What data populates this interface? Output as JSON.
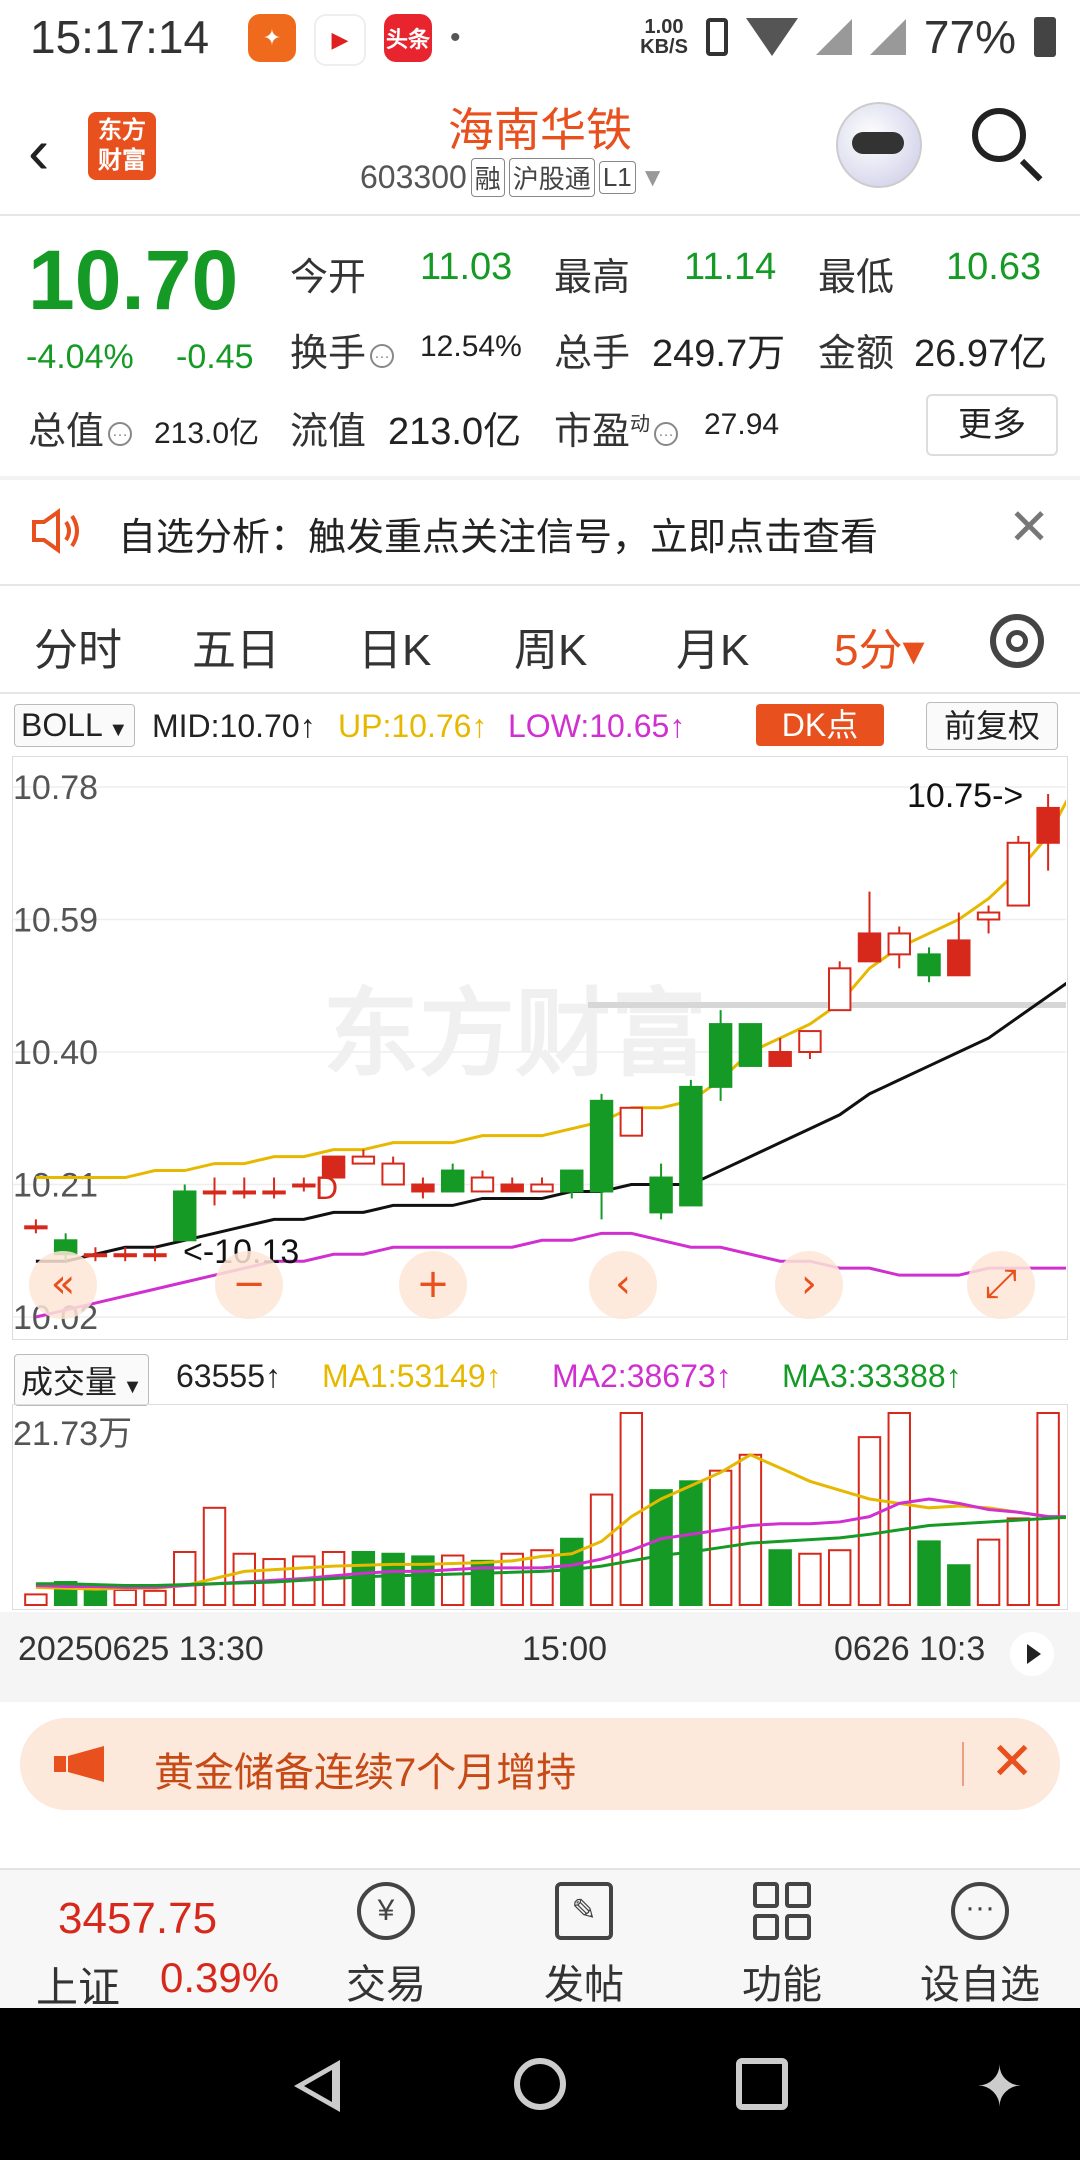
{
  "status": {
    "time": "15:17:14",
    "net_speed_value": "1.00",
    "net_speed_unit": "KB/S",
    "battery": "77%",
    "app1_label": "头条"
  },
  "header": {
    "logo_text": "东方财富",
    "stock_name": "海南华铁",
    "stock_code": "603300",
    "tags": [
      "融",
      "沪股通",
      "L1"
    ]
  },
  "quote": {
    "price": "10.70",
    "change_pct": "-4.04%",
    "change_abs": "-0.45",
    "open_label": "今开",
    "open": "11.03",
    "high_label": "最高",
    "high": "11.14",
    "low_label": "最低",
    "low": "10.63",
    "turnover_label": "换手",
    "turnover": "12.54%",
    "volume_label": "总手",
    "volume": "249.7万",
    "amount_label": "金额",
    "amount": "26.97亿",
    "total_value_label": "总值",
    "total_value": "213.0亿",
    "float_value_label": "流值",
    "float_value": "213.0亿",
    "pe_label": "市盈",
    "pe_sup": "动",
    "pe": "27.94",
    "more_label": "更多"
  },
  "notice": {
    "text": "自选分析：触发重点关注信号，立即点击查看"
  },
  "tabs": [
    "分时",
    "五日",
    "日K",
    "周K",
    "月K",
    "5分▾"
  ],
  "indicator": {
    "name": "BOLL",
    "mid": "MID:10.70↑",
    "up": "UP:10.76↑",
    "low": "LOW:10.65↑",
    "dk_label": "DK点",
    "adjust_label": "前复权"
  },
  "chart_labels": {
    "y_ticks": [
      "10.78",
      "10.59",
      "10.40",
      "10.21",
      "10.02"
    ],
    "high_marker": "10.75->",
    "low_marker": "<-10.13",
    "d_marker": "D",
    "watermark": "东方财富",
    "vol_max": "21.73万"
  },
  "volume": {
    "name": "成交量",
    "current": "63555↑",
    "ma1": "MA1:53149↑",
    "ma2": "MA2:38673↑",
    "ma3": "MA3:33388↑"
  },
  "time_axis": [
    "20250625 13:30",
    "15:00",
    "0626 10:3"
  ],
  "banner": {
    "text": "黄金储备连续7个月增持"
  },
  "bottom_bar": {
    "index_value": "3457.75",
    "index_name": "上证",
    "index_pct": "0.39%",
    "items": [
      "交易",
      "发帖",
      "功能",
      "设自选"
    ]
  },
  "colors": {
    "up": "#d7281c",
    "down": "#159a25",
    "accent": "#e8501e",
    "ma_yellow": "#e6b800",
    "ma_magenta": "#d030d0",
    "ma_black": "#111111"
  },
  "chart_data": {
    "type": "candlestick",
    "y_range": [
      10.02,
      10.78
    ],
    "candles": [
      {
        "o": 10.15,
        "c": 10.15,
        "h": 10.16,
        "l": 10.14
      },
      {
        "o": 10.13,
        "c": 10.11,
        "h": 10.14,
        "l": 10.1
      },
      {
        "o": 10.11,
        "c": 10.11,
        "h": 10.12,
        "l": 10.1
      },
      {
        "o": 10.11,
        "c": 10.11,
        "h": 10.12,
        "l": 10.1
      },
      {
        "o": 10.11,
        "c": 10.11,
        "h": 10.12,
        "l": 10.1
      },
      {
        "o": 10.2,
        "c": 10.13,
        "h": 10.21,
        "l": 10.13
      },
      {
        "o": 10.2,
        "c": 10.2,
        "h": 10.22,
        "l": 10.18
      },
      {
        "o": 10.2,
        "c": 10.2,
        "h": 10.22,
        "l": 10.19
      },
      {
        "o": 10.2,
        "c": 10.2,
        "h": 10.22,
        "l": 10.19
      },
      {
        "o": 10.21,
        "c": 10.21,
        "h": 10.22,
        "l": 10.2
      },
      {
        "o": 10.22,
        "c": 10.25,
        "h": 10.25,
        "l": 10.22
      },
      {
        "o": 10.24,
        "c": 10.25,
        "h": 10.26,
        "l": 10.24
      },
      {
        "o": 10.21,
        "c": 10.24,
        "h": 10.25,
        "l": 10.21
      },
      {
        "o": 10.2,
        "c": 10.21,
        "h": 10.22,
        "l": 10.19
      },
      {
        "o": 10.23,
        "c": 10.2,
        "h": 10.24,
        "l": 10.2
      },
      {
        "o": 10.2,
        "c": 10.22,
        "h": 10.23,
        "l": 10.2
      },
      {
        "o": 10.2,
        "c": 10.21,
        "h": 10.22,
        "l": 10.2
      },
      {
        "o": 10.2,
        "c": 10.21,
        "h": 10.22,
        "l": 10.2
      },
      {
        "o": 10.23,
        "c": 10.2,
        "h": 10.23,
        "l": 10.19
      },
      {
        "o": 10.33,
        "c": 10.2,
        "h": 10.34,
        "l": 10.16
      },
      {
        "o": 10.28,
        "c": 10.32,
        "h": 10.32,
        "l": 10.28
      },
      {
        "o": 10.22,
        "c": 10.17,
        "h": 10.24,
        "l": 10.16
      },
      {
        "o": 10.35,
        "c": 10.18,
        "h": 10.36,
        "l": 10.18
      },
      {
        "o": 10.44,
        "c": 10.35,
        "h": 10.46,
        "l": 10.33
      },
      {
        "o": 10.44,
        "c": 10.38,
        "h": 10.44,
        "l": 10.38
      },
      {
        "o": 10.38,
        "c": 10.4,
        "h": 10.42,
        "l": 10.38
      },
      {
        "o": 10.4,
        "c": 10.43,
        "h": 10.43,
        "l": 10.39
      },
      {
        "o": 10.46,
        "c": 10.52,
        "h": 10.53,
        "l": 10.46
      },
      {
        "o": 10.53,
        "c": 10.57,
        "h": 10.63,
        "l": 10.53
      },
      {
        "o": 10.54,
        "c": 10.57,
        "h": 10.58,
        "l": 10.52
      },
      {
        "o": 10.54,
        "c": 10.51,
        "h": 10.55,
        "l": 10.5
      },
      {
        "o": 10.51,
        "c": 10.56,
        "h": 10.6,
        "l": 10.51
      },
      {
        "o": 10.59,
        "c": 10.6,
        "h": 10.61,
        "l": 10.57
      },
      {
        "o": 10.61,
        "c": 10.7,
        "h": 10.71,
        "l": 10.61
      },
      {
        "o": 10.7,
        "c": 10.75,
        "h": 10.77,
        "l": 10.66
      }
    ],
    "volumes": [
      {
        "v": 12000,
        "up": true
      },
      {
        "v": 26000,
        "up": false
      },
      {
        "v": 20000,
        "up": false
      },
      {
        "v": 17000,
        "up": true
      },
      {
        "v": 16000,
        "up": true
      },
      {
        "v": 60000,
        "up": true
      },
      {
        "v": 110000,
        "up": true
      },
      {
        "v": 58000,
        "up": true
      },
      {
        "v": 52000,
        "up": true
      },
      {
        "v": 55000,
        "up": true
      },
      {
        "v": 60000,
        "up": true
      },
      {
        "v": 60000,
        "up": false
      },
      {
        "v": 58000,
        "up": false
      },
      {
        "v": 55000,
        "up": false
      },
      {
        "v": 56000,
        "up": true
      },
      {
        "v": 50000,
        "up": false
      },
      {
        "v": 58000,
        "up": true
      },
      {
        "v": 62000,
        "up": true
      },
      {
        "v": 75000,
        "up": false
      },
      {
        "v": 125000,
        "up": true
      },
      {
        "v": 217300,
        "up": true
      },
      {
        "v": 130000,
        "up": false
      },
      {
        "v": 140000,
        "up": false
      },
      {
        "v": 152000,
        "up": true
      },
      {
        "v": 170000,
        "up": true
      },
      {
        "v": 62000,
        "up": false
      },
      {
        "v": 58000,
        "up": true
      },
      {
        "v": 62000,
        "up": true
      },
      {
        "v": 190000,
        "up": true
      },
      {
        "v": 217300,
        "up": true
      },
      {
        "v": 72000,
        "up": false
      },
      {
        "v": 45000,
        "up": false
      },
      {
        "v": 74000,
        "up": true
      },
      {
        "v": 98000,
        "up": true
      },
      {
        "v": 217300,
        "up": true
      },
      {
        "v": 140000,
        "up": true
      }
    ],
    "boll_up": [
      10.22,
      10.22,
      10.22,
      10.22,
      10.23,
      10.23,
      10.24,
      10.24,
      10.25,
      10.25,
      10.26,
      10.26,
      10.27,
      10.27,
      10.27,
      10.28,
      10.28,
      10.28,
      10.29,
      10.3,
      10.32,
      10.32,
      10.33,
      10.36,
      10.4,
      10.42,
      10.44,
      10.47,
      10.52,
      10.55,
      10.57,
      10.59,
      10.62,
      10.66,
      10.71,
      10.79
    ],
    "boll_mid": [
      10.1,
      10.1,
      10.11,
      10.12,
      10.12,
      10.13,
      10.14,
      10.15,
      10.16,
      10.16,
      10.17,
      10.17,
      10.18,
      10.18,
      10.18,
      10.19,
      10.19,
      10.19,
      10.2,
      10.2,
      10.21,
      10.21,
      10.21,
      10.23,
      10.25,
      10.27,
      10.29,
      10.31,
      10.34,
      10.36,
      10.38,
      10.4,
      10.42,
      10.45,
      10.48,
      10.51
    ],
    "boll_low": [
      10.02,
      10.03,
      10.04,
      10.05,
      10.06,
      10.07,
      10.08,
      10.09,
      10.1,
      10.1,
      10.11,
      10.11,
      10.12,
      10.12,
      10.12,
      10.12,
      10.12,
      10.13,
      10.13,
      10.14,
      10.14,
      10.13,
      10.12,
      10.12,
      10.11,
      10.1,
      10.1,
      10.09,
      10.09,
      10.08,
      10.08,
      10.08,
      10.09,
      10.09,
      10.09,
      10.09
    ],
    "vol_ma1": [
      20000,
      19000,
      18000,
      19000,
      19000,
      22000,
      30000,
      38000,
      40000,
      42000,
      44000,
      45000,
      46000,
      46000,
      47000,
      48000,
      50000,
      55000,
      58000,
      72000,
      100000,
      120000,
      135000,
      150000,
      170000,
      155000,
      140000,
      130000,
      120000,
      115000,
      110000,
      112000,
      110000,
      105000,
      100000,
      98000
    ],
    "vol_ma2": [
      22000,
      21000,
      21000,
      20000,
      20000,
      22000,
      24000,
      26000,
      28000,
      30000,
      33000,
      36000,
      38000,
      38000,
      40000,
      42000,
      42000,
      42000,
      45000,
      52000,
      62000,
      75000,
      80000,
      85000,
      90000,
      92000,
      92000,
      94000,
      100000,
      115000,
      120000,
      115000,
      108000,
      105000,
      100000,
      100000
    ],
    "vol_ma3": [
      24000,
      24000,
      23000,
      22000,
      22000,
      23000,
      24000,
      25000,
      26000,
      28000,
      30000,
      32000,
      33000,
      34000,
      35000,
      36000,
      37000,
      38000,
      40000,
      44000,
      50000,
      56000,
      60000,
      65000,
      70000,
      72000,
      74000,
      76000,
      80000,
      85000,
      90000,
      92000,
      94000,
      96000,
      98000,
      100000
    ]
  }
}
